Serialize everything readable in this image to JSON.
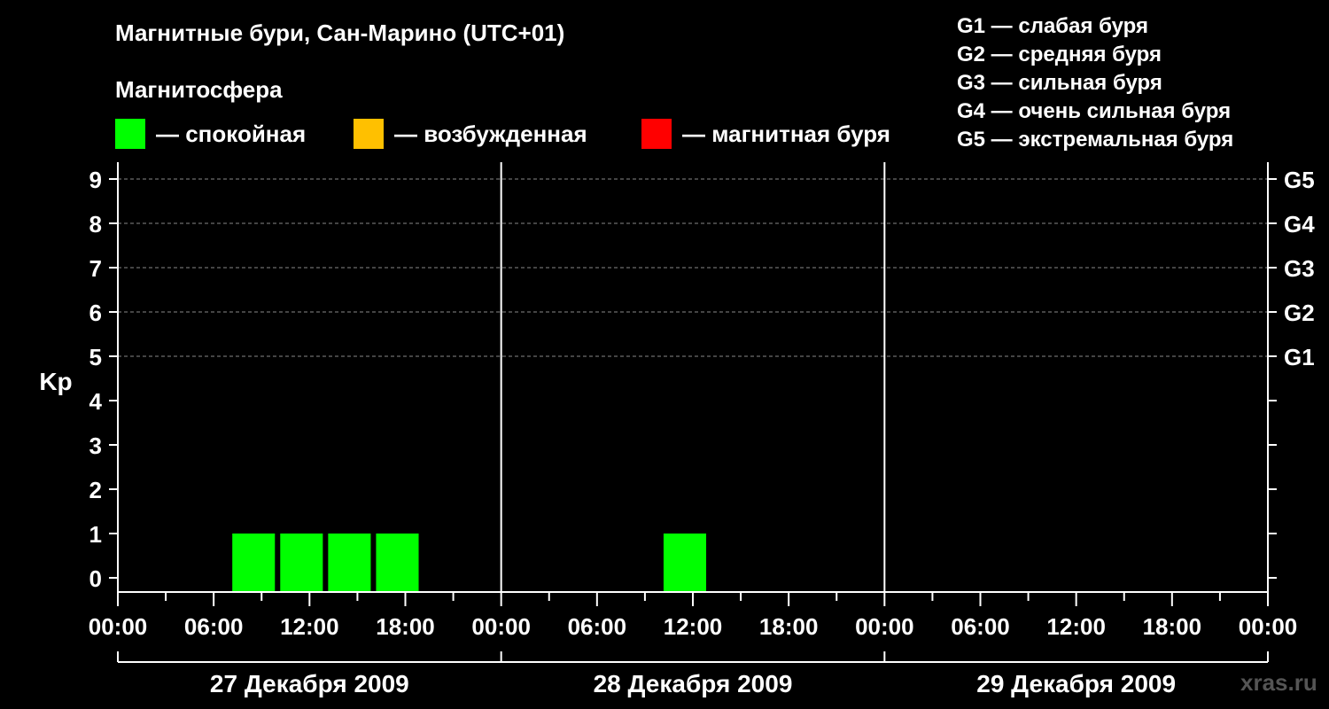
{
  "header": {
    "title": "Магнитные бури, Сан-Марино (UTC+01)",
    "subtitle": "Магнитосфера"
  },
  "legend": {
    "items": [
      {
        "label": "— спокойная",
        "color": "#00ff00"
      },
      {
        "label": "— возбужденная",
        "color": "#ffc000"
      },
      {
        "label": "— магнитная буря",
        "color": "#ff0000"
      }
    ]
  },
  "g_legend": [
    "G1 — слабая буря",
    "G2 — средняя буря",
    "G3 — сильная буря",
    "G4 — очень сильная буря",
    "G5 — экстремальная буря"
  ],
  "watermark": "xras.ru",
  "chart_data": {
    "type": "bar",
    "ylabel": "Kp",
    "ylim": [
      0,
      9
    ],
    "y_ticks": [
      0,
      1,
      2,
      3,
      4,
      5,
      6,
      7,
      8,
      9
    ],
    "right_axis_labels": [
      {
        "kp": 5,
        "label": "G1"
      },
      {
        "kp": 6,
        "label": "G2"
      },
      {
        "kp": 7,
        "label": "G3"
      },
      {
        "kp": 8,
        "label": "G4"
      },
      {
        "kp": 9,
        "label": "G5"
      }
    ],
    "grid_dashed_at": [
      5,
      6,
      7,
      8,
      9
    ],
    "x_ticks": [
      "00:00",
      "06:00",
      "12:00",
      "18:00",
      "00:00",
      "06:00",
      "12:00",
      "18:00",
      "00:00",
      "06:00",
      "12:00",
      "18:00",
      "00:00"
    ],
    "days": [
      "27 Декабря 2009",
      "28 Декабря 2009",
      "29 Декабря 2009"
    ],
    "colors": {
      "quiet": "#00ff00",
      "active": "#ffc000",
      "storm": "#ff0000"
    },
    "bars": [
      {
        "day": 0,
        "start_hour": 7,
        "end_hour": 10,
        "kp": 1,
        "color": "#00ff00"
      },
      {
        "day": 0,
        "start_hour": 10,
        "end_hour": 13,
        "kp": 1,
        "color": "#00ff00"
      },
      {
        "day": 0,
        "start_hour": 13,
        "end_hour": 16,
        "kp": 1,
        "color": "#00ff00"
      },
      {
        "day": 0,
        "start_hour": 16,
        "end_hour": 19,
        "kp": 1,
        "color": "#00ff00"
      },
      {
        "day": 1,
        "start_hour": 10,
        "end_hour": 13,
        "kp": 1,
        "color": "#00ff00"
      }
    ]
  }
}
